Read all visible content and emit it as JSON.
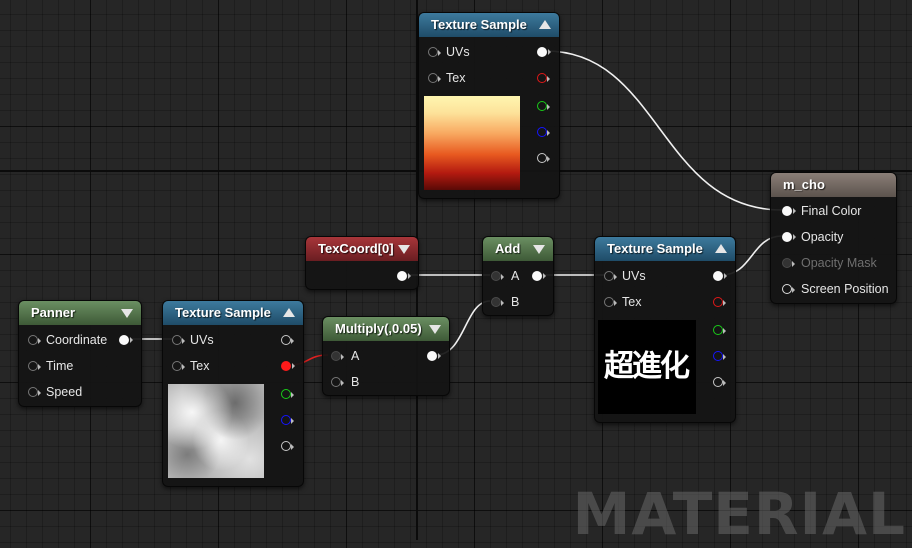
{
  "nodes": {
    "texture_sample_top": {
      "title": "Texture Sample",
      "inputs": [
        "UVs",
        "Tex"
      ]
    },
    "m_cho": {
      "title": "m_cho",
      "inputs": [
        "Final Color",
        "Opacity",
        "Opacity Mask",
        "Screen Position"
      ]
    },
    "texcoord": {
      "title": "TexCoord[0]"
    },
    "add": {
      "title": "Add",
      "inputs": [
        "A",
        "B"
      ]
    },
    "texture_sample_mid": {
      "title": "Texture Sample",
      "inputs": [
        "UVs",
        "Tex"
      ],
      "preview_text": "超進化"
    },
    "panner": {
      "title": "Panner",
      "inputs": [
        "Coordinate",
        "Time",
        "Speed"
      ]
    },
    "texture_sample_left": {
      "title": "Texture Sample",
      "inputs": [
        "UVs",
        "Tex"
      ]
    },
    "multiply": {
      "title": "Multiply(,0.05)",
      "inputs": [
        "A",
        "B"
      ]
    }
  },
  "watermark": "MATERIAL",
  "colors": {
    "header_texture": "#2f6485",
    "header_math": "#55744d",
    "header_coord": "#8c2a2e",
    "header_result": "#776c65",
    "wire": "#ffffff",
    "pin_red": "#ff1a1a",
    "pin_green": "#19cc19",
    "pin_blue": "#1515ff"
  }
}
